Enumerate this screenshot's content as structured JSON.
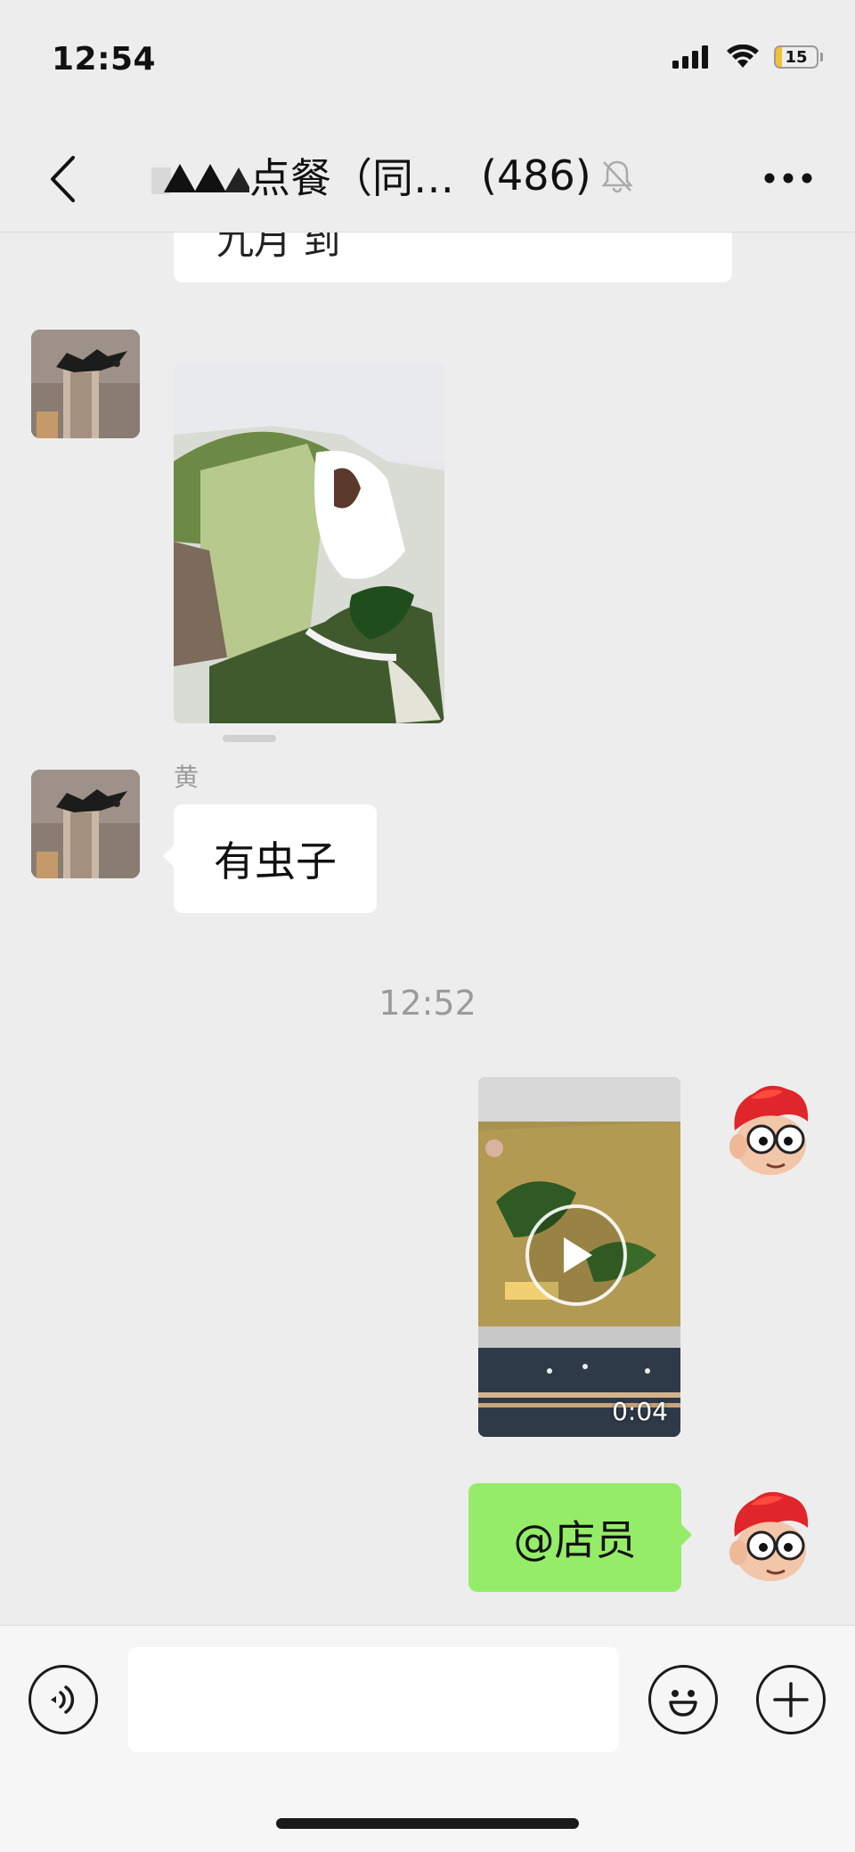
{
  "status_bar": {
    "time": "12:54",
    "battery_level": "15",
    "battery_fraction": 0.15,
    "battery_color": "#f1c232",
    "icons": [
      "cellular-signal-icon",
      "wifi-icon",
      "battery-icon"
    ]
  },
  "nav": {
    "title": "点餐（同…",
    "member_count": "(486)",
    "back_icon": "chevron-left-icon",
    "mute_icon": "bell-muted-icon",
    "more_icon": "ellipsis-icon"
  },
  "chat": {
    "partial_message": "九月 到",
    "messages": [
      {
        "type": "image",
        "side": "left",
        "description": "food-photo"
      },
      {
        "type": "text",
        "side": "left",
        "sender": "黄",
        "text": "有虫子"
      }
    ],
    "timestamp": "12:52",
    "video": {
      "duration": "0:04"
    },
    "my_text": "@店员"
  },
  "input_bar": {
    "voice_icon": "voice-icon",
    "emoji_icon": "emoji-icon",
    "plus_icon": "plus-icon",
    "placeholder": ""
  },
  "colors": {
    "background": "#ededed",
    "my_bubble": "#95ec69",
    "other_bubble": "#ffffff"
  }
}
